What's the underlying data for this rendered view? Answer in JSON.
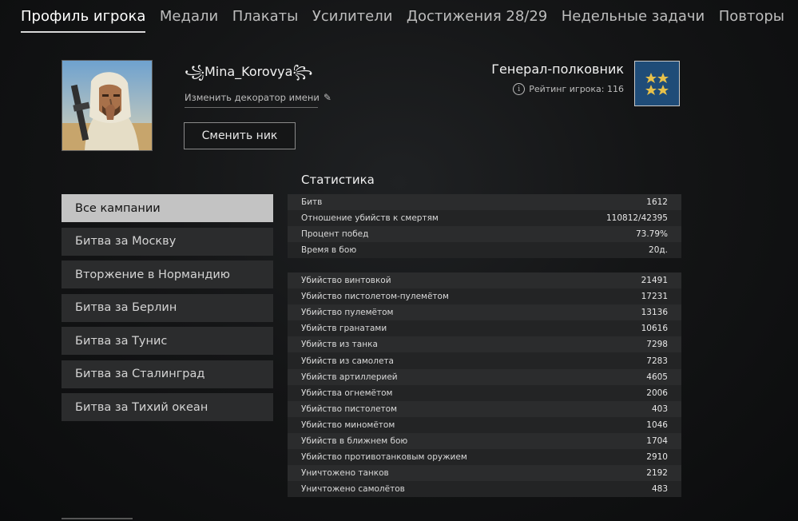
{
  "tabs": [
    {
      "label": "Профиль игрока",
      "active": true
    },
    {
      "label": "Медали",
      "active": false
    },
    {
      "label": "Плакаты",
      "active": false
    },
    {
      "label": "Усилители",
      "active": false
    },
    {
      "label": "Достижения 28/29",
      "active": false
    },
    {
      "label": "Недельные задачи",
      "active": false
    },
    {
      "label": "Повторы",
      "active": false
    }
  ],
  "profile": {
    "name": "꧁Mina_Korovya꧂",
    "decorator_link": "Изменить декоратор имени",
    "change_nick_button": "Сменить ник",
    "rank_title": "Генерал-полковник",
    "rating_text": "Рейтинг игрока: 116",
    "rank_badge_color": "#1f4c78"
  },
  "campaigns": [
    {
      "label": "Все кампании",
      "active": true
    },
    {
      "label": "Битва за Москву",
      "active": false
    },
    {
      "label": "Вторжение в Нормандию",
      "active": false
    },
    {
      "label": "Битва за Берлин",
      "active": false
    },
    {
      "label": "Битва за Тунис",
      "active": false
    },
    {
      "label": "Битва за Сталинград",
      "active": false
    },
    {
      "label": "Битва за Тихий океан",
      "active": false
    }
  ],
  "stats": {
    "heading": "Статистика",
    "general": [
      {
        "label": "Битв",
        "value": "1612"
      },
      {
        "label": "Отношение убийств к смертям",
        "value": "110812/42395"
      },
      {
        "label": "Процент побед",
        "value": "73.79%"
      },
      {
        "label": "Время в бою",
        "value": "20д."
      }
    ],
    "kills": [
      {
        "label": "Убийство винтовкой",
        "value": "21491"
      },
      {
        "label": "Убийство пистолетом-пулемётом",
        "value": "17231"
      },
      {
        "label": "Убийство пулемётом",
        "value": "13136"
      },
      {
        "label": "Убийств гранатами",
        "value": "10616"
      },
      {
        "label": "Убийств из танка",
        "value": "7298"
      },
      {
        "label": "Убийств из самолета",
        "value": "7283"
      },
      {
        "label": "Убийств артиллерией",
        "value": "4605"
      },
      {
        "label": "Убийства огнемётом",
        "value": "2006"
      },
      {
        "label": "Убийство пистолетом",
        "value": "403"
      },
      {
        "label": "Убийство миномётом",
        "value": "1046"
      },
      {
        "label": "Убийств в ближнем бою",
        "value": "1704"
      },
      {
        "label": "Убийство противотанковым оружием",
        "value": "2910"
      },
      {
        "label": "Уничтожено танков",
        "value": "2192"
      },
      {
        "label": "Уничтожено самолётов",
        "value": "483"
      }
    ]
  }
}
